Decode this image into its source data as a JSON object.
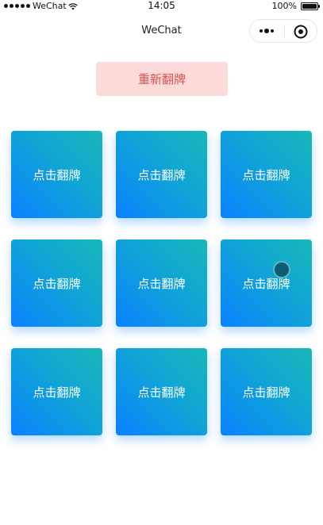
{
  "status_bar": {
    "carrier": "WeChat",
    "time": "14:05",
    "battery": "100%",
    "battery_level": 1.0,
    "icons": [
      "signal-icon",
      "wifi-icon",
      "battery-icon"
    ]
  },
  "nav": {
    "title": "WeChat",
    "capsule_icons": [
      "more-icon",
      "close-icon"
    ]
  },
  "reset_button": {
    "label": "重新翻牌"
  },
  "cards": [
    {
      "label": "点击翻牌"
    },
    {
      "label": "点击翻牌"
    },
    {
      "label": "点击翻牌"
    },
    {
      "label": "点击翻牌"
    },
    {
      "label": "点击翻牌"
    },
    {
      "label": "点击翻牌"
    },
    {
      "label": "点击翻牌"
    },
    {
      "label": "点击翻牌"
    },
    {
      "label": "点击翻牌"
    }
  ],
  "colors": {
    "card_gradient_start": "#0a82ff",
    "card_gradient_end": "#18b8b8",
    "reset_bg": "#fcdada",
    "reset_text": "#d9534f",
    "touch_indicator": "#0d5c70"
  }
}
